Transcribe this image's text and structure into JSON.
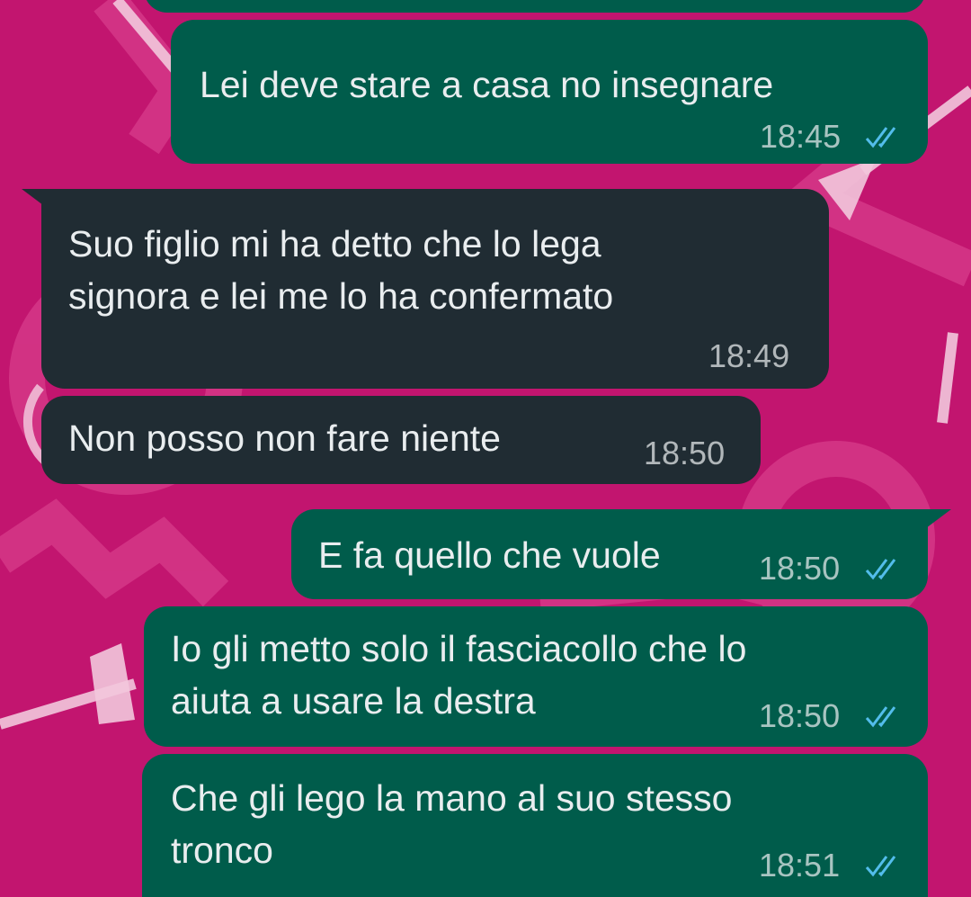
{
  "colors": {
    "wallpaper": "#c2156f",
    "outgoing_bubble": "#005c4b",
    "incoming_bubble": "#202c33",
    "text": "#e9edef",
    "read_ticks": "#53bdeb"
  },
  "messages": [
    {
      "direction": "outgoing",
      "text": "Lei deve stare a casa no insegnare",
      "time": "18:45",
      "status_icon": "double-check-read-icon"
    },
    {
      "direction": "incoming",
      "lines": [
        "Suo figlio mi ha detto che lo lega",
        "signora e lei me lo ha confermato"
      ],
      "time": "18:49"
    },
    {
      "direction": "incoming",
      "text": "Non posso non fare niente",
      "time": "18:50"
    },
    {
      "direction": "outgoing",
      "text": "E fa quello che vuole",
      "time": "18:50",
      "status_icon": "double-check-read-icon"
    },
    {
      "direction": "outgoing",
      "lines": [
        "Io gli metto solo il fasciacollo che lo",
        "aiuta a usare la destra"
      ],
      "time": "18:50",
      "status_icon": "double-check-read-icon"
    },
    {
      "direction": "outgoing",
      "lines": [
        "Che gli lego la mano al suo stesso",
        "tronco"
      ],
      "time": "18:51",
      "status_icon": "double-check-read-icon"
    }
  ]
}
